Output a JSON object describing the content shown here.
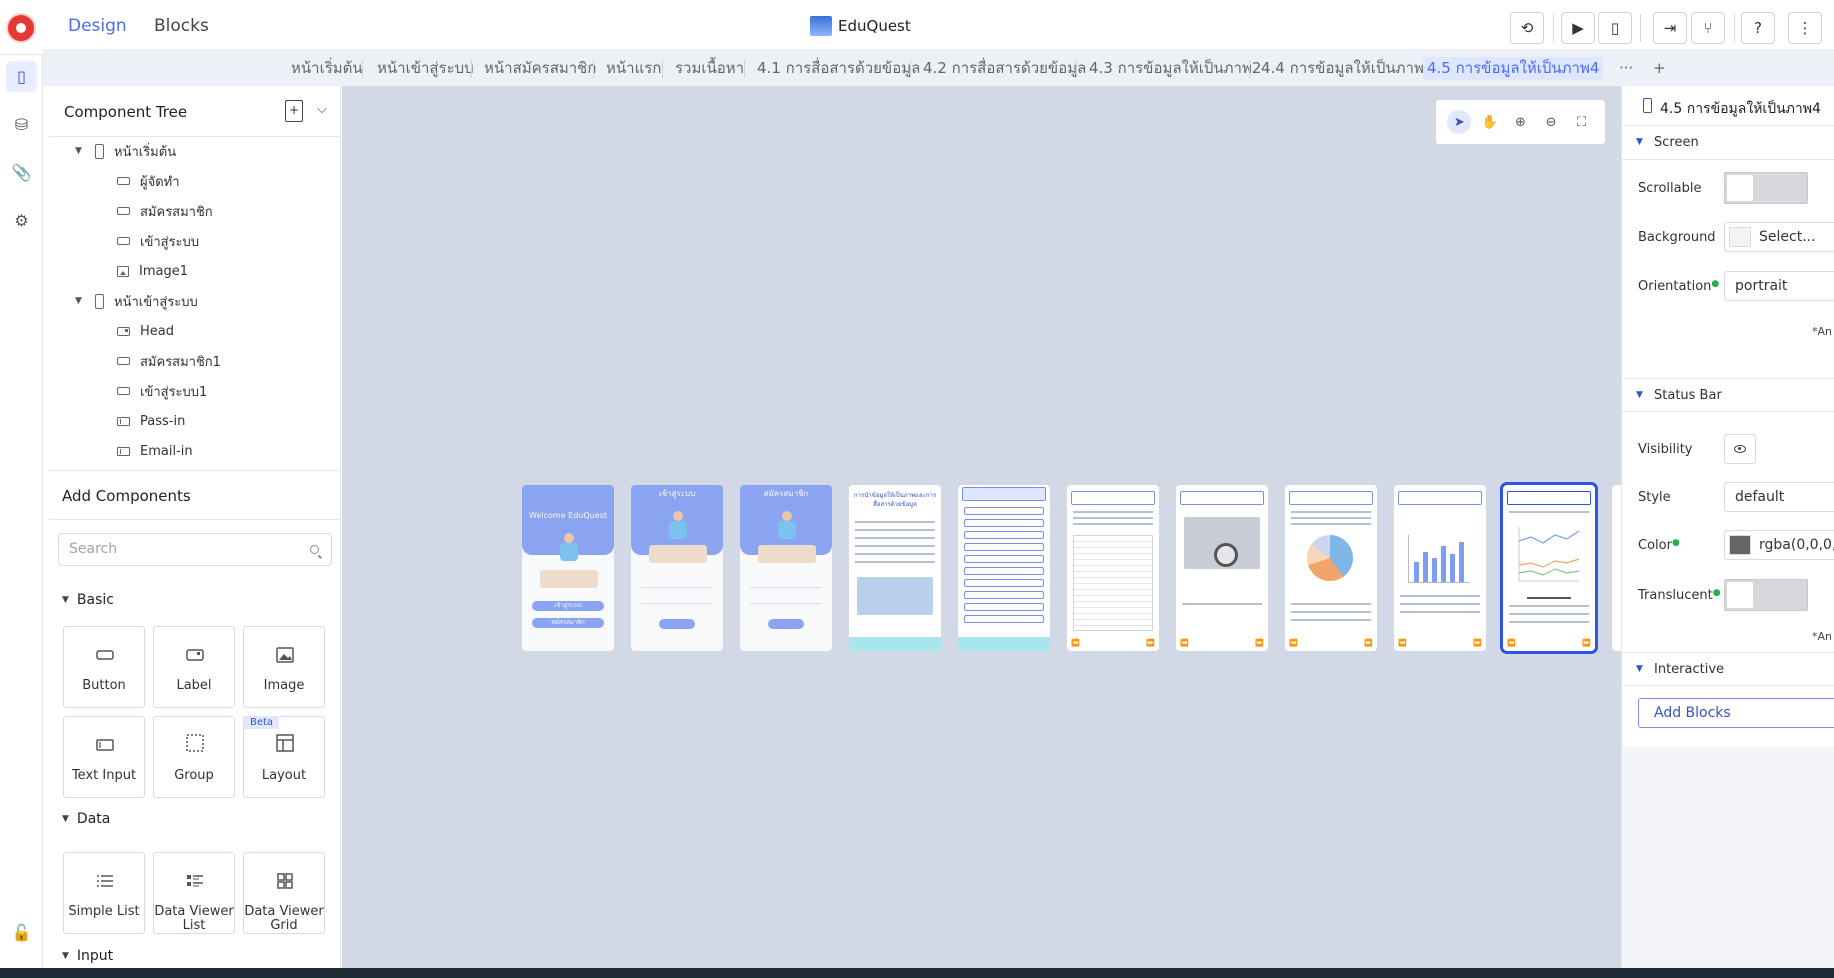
{
  "header": {
    "tabs": [
      {
        "label": "Design",
        "active": true
      },
      {
        "label": "Blocks",
        "active": false
      }
    ],
    "app_title": "EduQuest",
    "toolbar_icons": [
      "history-icon",
      "preview-icon",
      "device-preview-icon",
      "export-icon",
      "share-icon",
      "help-icon",
      "more-vertical-icon"
    ],
    "help_label": "?",
    "more_label": "⋮"
  },
  "rail": {
    "items": [
      "screens-icon",
      "database-icon",
      "assets-icon",
      "settings-icon"
    ],
    "bottom": "lock-icon"
  },
  "page_tabs": [
    "หน้าเริ่มต้น",
    "หน้าเข้าสู่ระบบ",
    "หน้าสมัครสมาชิก",
    "หน้าแรก",
    "รวมเนื้อหา",
    "4.1 การสื่อสารด้วยข้อมูล",
    "4.2 การสื่อสารด้วยข้อมูล",
    "4.3 การข้อมูลให้เป็นภาพ2",
    "4.4 การข้อมูลให้เป็นภาพ3",
    "4.5 การข้อมูลให้เป็นภาพ4"
  ],
  "page_tabs_active": 9,
  "page_tabs_more": "···",
  "page_tabs_add": "+",
  "component_tree": {
    "title": "Component Tree",
    "rows": [
      {
        "label": "หน้าเริ่มต้น",
        "type": "screen",
        "level": 0
      },
      {
        "label": "ผู้จัดทำ",
        "type": "button",
        "level": 1
      },
      {
        "label": "สมัครสมาชิก",
        "type": "button",
        "level": 1
      },
      {
        "label": "เข้าสู่ระบบ",
        "type": "button",
        "level": 1
      },
      {
        "label": "Image1",
        "type": "image",
        "level": 1
      },
      {
        "label": "หน้าเข้าสู่ระบบ",
        "type": "screen",
        "level": 0
      },
      {
        "label": "Head",
        "type": "label",
        "level": 1
      },
      {
        "label": "สมัครสมาชิก1",
        "type": "button",
        "level": 1
      },
      {
        "label": "เข้าสู่ระบบ1",
        "type": "button",
        "level": 1
      },
      {
        "label": "Pass-in",
        "type": "input",
        "level": 1
      },
      {
        "label": "Email-in",
        "type": "input",
        "level": 1
      }
    ]
  },
  "add_components": {
    "title": "Add Components",
    "search_placeholder": "Search",
    "sections": [
      {
        "title": "Basic",
        "items": [
          {
            "label": "Button",
            "icon": "button-icon"
          },
          {
            "label": "Label",
            "icon": "label-icon"
          },
          {
            "label": "Image",
            "icon": "image-icon"
          },
          {
            "label": "Text Input",
            "icon": "text-input-icon"
          },
          {
            "label": "Group",
            "icon": "group-icon"
          },
          {
            "label": "Layout",
            "icon": "layout-icon",
            "badge": "Beta"
          }
        ]
      },
      {
        "title": "Data",
        "items": [
          {
            "label": "Simple List",
            "icon": "list-icon"
          },
          {
            "label": "Data Viewer List",
            "icon": "data-list-icon"
          },
          {
            "label": "Data Viewer Grid",
            "icon": "grid-icon"
          }
        ]
      },
      {
        "title": "Input",
        "items": []
      }
    ]
  },
  "canvas": {
    "tools": [
      "select-icon",
      "hand-icon",
      "zoom-in-icon",
      "zoom-out-icon",
      "fit-icon"
    ],
    "thumbnails": {
      "welcome": "Welcome EduQuest",
      "welcome_btn1": "เข้าสู่ระบบ",
      "welcome_btn2": "สมัครสมาชิก",
      "login_title": "เข้าสู่ระบบ",
      "signup_title": "สมัครสมาชิก",
      "content_title": "การนำข้อมูลให้เป็นภาพและการสื่อสารด้วยข้อมูล"
    }
  },
  "properties": {
    "title": "4.5 การข้อมูลให้เป็นภาพ4",
    "screen_section": "Screen",
    "scrollable_label": "Scrollable",
    "scrollable": false,
    "background_label": "Background",
    "background_value": "Select...",
    "orientation_label": "Orientation",
    "orientation_value": "portrait",
    "note1": "*An",
    "status_bar_section": "Status Bar",
    "visibility_label": "Visibility",
    "style_label": "Style",
    "style_value": "default",
    "color_label": "Color",
    "color_value": "rgba(0,0,0,0",
    "translucent_label": "Translucent",
    "translucent": false,
    "note2": "*An",
    "interactive_section": "Interactive",
    "add_blocks_label": "Add Blocks"
  },
  "colors": {
    "accent": "#4a6cf7",
    "canvas_bg": "#d3d8e7",
    "selected_outline": "#2e54e0"
  }
}
